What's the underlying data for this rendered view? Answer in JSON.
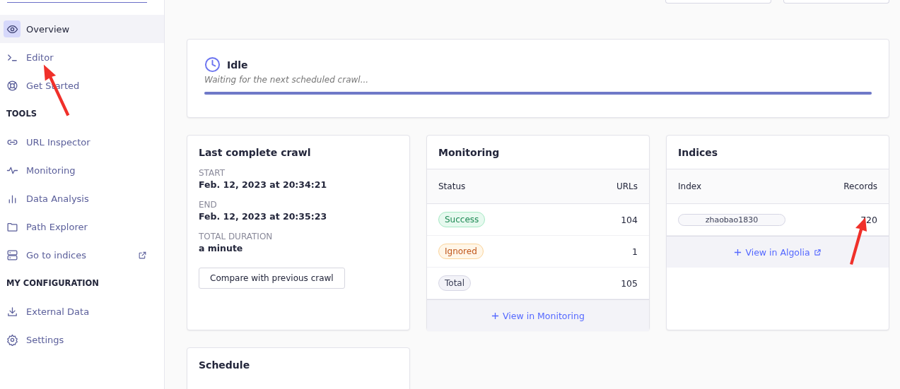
{
  "sidebar": {
    "items": [
      {
        "label": "Overview",
        "selected": true
      },
      {
        "label": "Editor",
        "selected": false
      },
      {
        "label": "Get Started",
        "selected": false
      }
    ],
    "sections": [
      {
        "title": "TOOLS",
        "items": [
          {
            "label": "URL Inspector",
            "selected": false
          },
          {
            "label": "Monitoring",
            "selected": false
          },
          {
            "label": "Data Analysis",
            "selected": false
          },
          {
            "label": "Path Explorer",
            "selected": false
          },
          {
            "label": "Go to indices",
            "selected": false,
            "external": true
          }
        ]
      },
      {
        "title": "MY CONFIGURATION",
        "items": [
          {
            "label": "External Data",
            "selected": false
          },
          {
            "label": "Settings",
            "selected": false
          }
        ]
      }
    ]
  },
  "status": {
    "title": "Idle",
    "message": "Waiting for the next scheduled crawl...",
    "level": 1
  },
  "last_crawl": {
    "title": "Last complete crawl",
    "fields": [
      {
        "label": "START",
        "value": "Feb. 12, 2023 at 20:34:21"
      },
      {
        "label": "END",
        "value": "Feb. 12, 2023 at 20:35:23"
      },
      {
        "label": "TOTAL DURATION",
        "value": "a minute"
      }
    ],
    "button": "Compare with previous crawl"
  },
  "monitoring": {
    "title": "Monitoring",
    "columns": [
      "Status",
      "URLs"
    ],
    "rows": [
      {
        "status": "Success",
        "kind": "success",
        "urls": "104"
      },
      {
        "status": "Ignored",
        "kind": "warning",
        "urls": "1"
      },
      {
        "status": "Total",
        "kind": "neutral",
        "urls": "105"
      }
    ],
    "link": "View in Monitoring"
  },
  "indices": {
    "title": "Indices",
    "columns": [
      "Index",
      "Records"
    ],
    "rows": [
      {
        "index": "zhaobao1830",
        "records": "720"
      }
    ],
    "link": "View in Algolia"
  },
  "schedule": {
    "title": "Schedule"
  }
}
